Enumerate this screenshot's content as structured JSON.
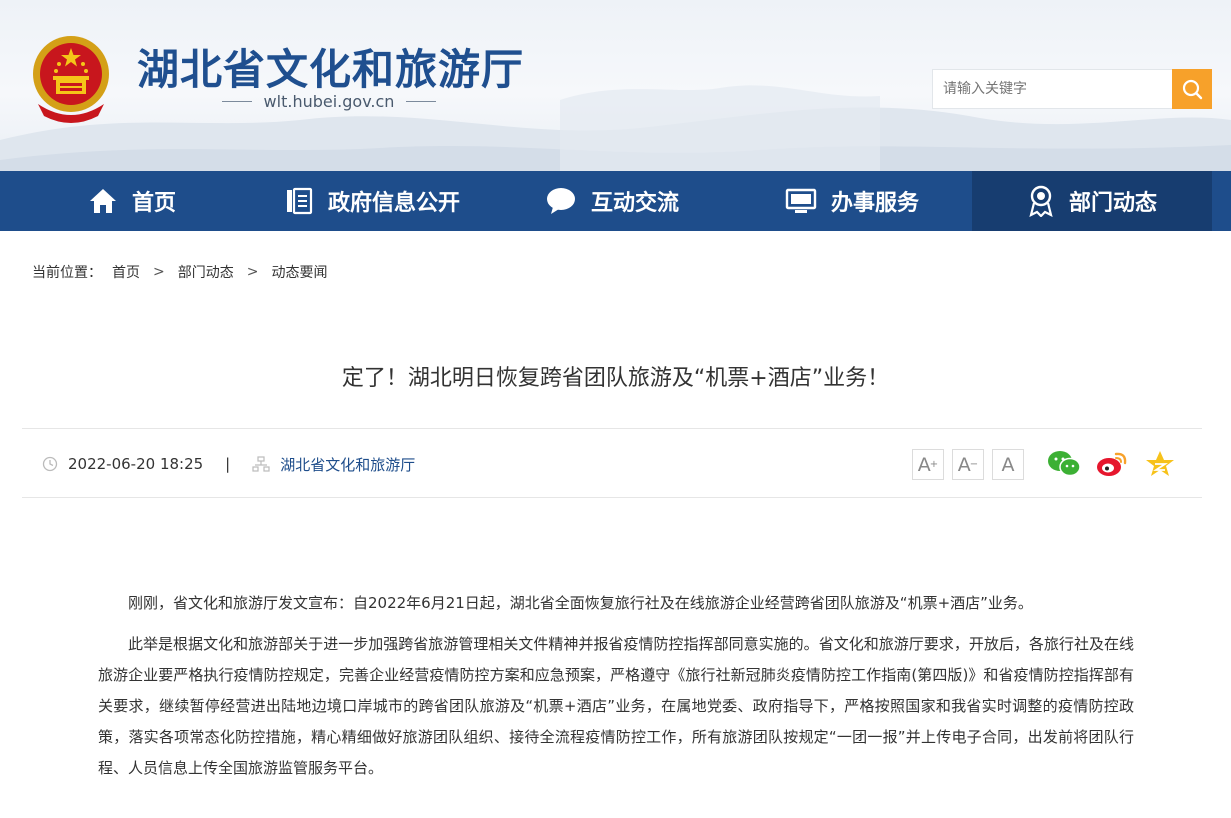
{
  "header": {
    "site_title": "湖北省文化和旅游厅",
    "site_domain": "wlt.hubei.gov.cn",
    "emblem_icon": "national-emblem-icon",
    "search": {
      "placeholder": "请输入关键字",
      "button_icon": "search-icon"
    }
  },
  "nav": {
    "items": [
      {
        "label": "首页",
        "icon": "home-icon"
      },
      {
        "label": "政府信息公开",
        "icon": "document-list-icon"
      },
      {
        "label": "互动交流",
        "icon": "chat-bubble-icon"
      },
      {
        "label": "办事服务",
        "icon": "monitor-icon"
      },
      {
        "label": "部门动态",
        "icon": "award-badge-icon"
      }
    ],
    "active_index": 4
  },
  "breadcrumb": {
    "prefix": "当前位置：",
    "items": [
      "首页",
      "部门动态",
      "动态要闻"
    ],
    "separator": ">"
  },
  "article": {
    "title": "定了！湖北明日恢复跨省团队旅游及“机票+酒店”业务！",
    "datetime": "2022-06-20 18:25",
    "divider": "|",
    "source": "湖北省文化和旅游厅",
    "font_size_buttons": [
      "A",
      "A",
      "A"
    ],
    "share_icons": [
      "wechat-icon",
      "weibo-icon",
      "qzone-star-icon"
    ],
    "paragraphs": [
      "刚刚，省文化和旅游厅发文宣布：自2022年6月21日起，湖北省全面恢复旅行社及在线旅游企业经营跨省团队旅游及“机票+酒店”业务。",
      "此举是根据文化和旅游部关于进一步加强跨省旅游管理相关文件精神并报省疫情防控指挥部同意实施的。省文化和旅游厅要求，开放后，各旅行社及在线旅游企业要严格执行疫情防控规定，完善企业经营疫情防控方案和应急预案，严格遵守《旅行社新冠肺炎疫情防控工作指南(第四版)》和省疫情防控指挥部有关要求，继续暂停经营进出陆地边境口岸城市的跨省团队旅游及“机票+酒店”业务，在属地党委、政府指导下，严格按照国家和我省实时调整的疫情防控政策，落实各项常态化防控措施，精心精细做好旅游团队组织、接待全流程疫情防控工作，所有旅游团队按规定“一团一报”并上传电子合同，出发前将团队行程、人员信息上传全国旅游监管服务平台。"
    ]
  },
  "colors": {
    "nav_bg": "#1e4d8b",
    "nav_active_bg": "#173d70",
    "title_blue": "#1f4f8f",
    "search_orange": "#f7a12a"
  }
}
